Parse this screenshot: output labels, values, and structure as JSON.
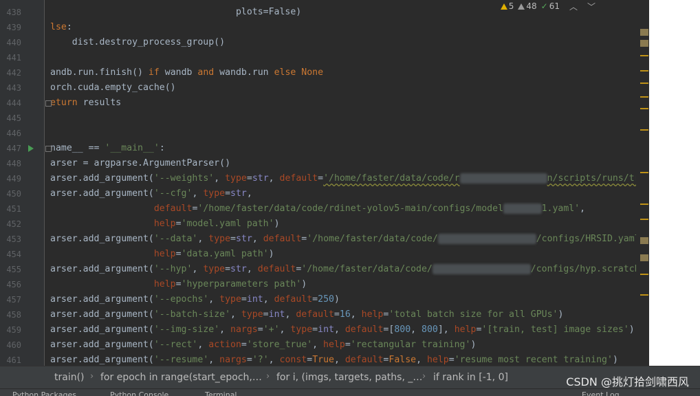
{
  "inspection": {
    "warnings_count": "5",
    "weak_warnings_count": "48",
    "typos_count": "61"
  },
  "lines": [
    {
      "num": "438",
      "tokens": [
        {
          "t": "                                  plots=False)",
          "c": ""
        }
      ]
    },
    {
      "num": "439",
      "tokens": [
        {
          "t": "lse",
          "c": "kw"
        },
        {
          "t": ":",
          "c": ""
        }
      ]
    },
    {
      "num": "440",
      "tokens": [
        {
          "t": "    dist.destroy_process_group()",
          "c": ""
        }
      ]
    },
    {
      "num": "441",
      "tokens": []
    },
    {
      "num": "442",
      "tokens": [
        {
          "t": "andb.run.finish() ",
          "c": ""
        },
        {
          "t": "if",
          "c": "kw"
        },
        {
          "t": " wandb ",
          "c": ""
        },
        {
          "t": "and",
          "c": "kw"
        },
        {
          "t": " wandb.run ",
          "c": ""
        },
        {
          "t": "else",
          "c": "kw"
        },
        {
          "t": " ",
          "c": ""
        },
        {
          "t": "None",
          "c": "kw"
        }
      ]
    },
    {
      "num": "443",
      "tokens": [
        {
          "t": "orch.cuda.empty_cache()",
          "c": ""
        }
      ]
    },
    {
      "num": "444",
      "tokens": [
        {
          "t": "eturn",
          "c": "kw"
        },
        {
          "t": " results",
          "c": ""
        }
      ]
    },
    {
      "num": "445",
      "tokens": []
    },
    {
      "num": "446",
      "tokens": []
    },
    {
      "num": "447",
      "tokens": [
        {
          "t": "name__ == ",
          "c": ""
        },
        {
          "t": "'__main__'",
          "c": "str"
        },
        {
          "t": ":",
          "c": ""
        }
      ]
    },
    {
      "num": "448",
      "tokens": [
        {
          "t": "arser = argparse.ArgumentParser()",
          "c": ""
        }
      ]
    },
    {
      "num": "449",
      "tokens": [
        {
          "t": "arser.add_argument(",
          "c": ""
        },
        {
          "t": "'--weights'",
          "c": "str"
        },
        {
          "t": ", ",
          "c": ""
        },
        {
          "t": "type",
          "c": "prm"
        },
        {
          "t": "=",
          "c": ""
        },
        {
          "t": "str",
          "c": "bi"
        },
        {
          "t": ", ",
          "c": ""
        },
        {
          "t": "default",
          "c": "prm"
        },
        {
          "t": "=",
          "c": ""
        },
        {
          "t": "'/home/faster/data/code/r",
          "c": "str wavy"
        },
        {
          "t": "dinet-yolov5-mai",
          "c": "str blur"
        },
        {
          "t": "n/scripts/runs/tra",
          "c": "str wavy"
        }
      ]
    },
    {
      "num": "450",
      "tokens": [
        {
          "t": "arser.add_argument(",
          "c": ""
        },
        {
          "t": "'--cfg'",
          "c": "str"
        },
        {
          "t": ", ",
          "c": ""
        },
        {
          "t": "type",
          "c": "prm"
        },
        {
          "t": "=",
          "c": ""
        },
        {
          "t": "str",
          "c": "bi"
        },
        {
          "t": ",",
          "c": ""
        }
      ]
    },
    {
      "num": "451",
      "tokens": [
        {
          "t": "                   ",
          "c": ""
        },
        {
          "t": "default",
          "c": "prm"
        },
        {
          "t": "=",
          "c": ""
        },
        {
          "t": "'/home/faster/data/code/rdinet-yolov5-main/configs/model",
          "c": "str"
        },
        {
          "t": "_xxxxxx",
          "c": "str blur"
        },
        {
          "t": "1.yaml'",
          "c": "str"
        },
        {
          "t": ",",
          "c": ""
        }
      ]
    },
    {
      "num": "452",
      "tokens": [
        {
          "t": "                   ",
          "c": ""
        },
        {
          "t": "help",
          "c": "prm"
        },
        {
          "t": "=",
          "c": ""
        },
        {
          "t": "'model.yaml path'",
          "c": "str"
        },
        {
          "t": ")",
          "c": ""
        }
      ]
    },
    {
      "num": "453",
      "tokens": [
        {
          "t": "arser.add_argument(",
          "c": ""
        },
        {
          "t": "'--data'",
          "c": "str"
        },
        {
          "t": ", ",
          "c": ""
        },
        {
          "t": "type",
          "c": "prm"
        },
        {
          "t": "=",
          "c": ""
        },
        {
          "t": "str",
          "c": "bi"
        },
        {
          "t": ", ",
          "c": ""
        },
        {
          "t": "default",
          "c": "prm"
        },
        {
          "t": "=",
          "c": ""
        },
        {
          "t": "'/home/faster/data/code/",
          "c": "str"
        },
        {
          "t": "rdinet-yolov5-main",
          "c": "str blur"
        },
        {
          "t": "/configs/HRSID.yaml'",
          "c": "str"
        }
      ]
    },
    {
      "num": "454",
      "tokens": [
        {
          "t": "                   ",
          "c": ""
        },
        {
          "t": "help",
          "c": "prm"
        },
        {
          "t": "=",
          "c": ""
        },
        {
          "t": "'data.yaml path'",
          "c": "str"
        },
        {
          "t": ")",
          "c": ""
        }
      ]
    },
    {
      "num": "455",
      "tokens": [
        {
          "t": "arser.add_argument(",
          "c": ""
        },
        {
          "t": "'--hyp'",
          "c": "str"
        },
        {
          "t": ", ",
          "c": ""
        },
        {
          "t": "type",
          "c": "prm"
        },
        {
          "t": "=",
          "c": ""
        },
        {
          "t": "str",
          "c": "bi"
        },
        {
          "t": ", ",
          "c": ""
        },
        {
          "t": "default",
          "c": "prm"
        },
        {
          "t": "=",
          "c": ""
        },
        {
          "t": "'/home/faster/data/code/",
          "c": "str"
        },
        {
          "t": "rdinet-yolov5-main",
          "c": "str blur"
        },
        {
          "t": "/configs/hyp.scratch.",
          "c": "str"
        }
      ]
    },
    {
      "num": "456",
      "tokens": [
        {
          "t": "                   ",
          "c": ""
        },
        {
          "t": "help",
          "c": "prm"
        },
        {
          "t": "=",
          "c": ""
        },
        {
          "t": "'hyperparameters path'",
          "c": "str"
        },
        {
          "t": ")",
          "c": ""
        }
      ]
    },
    {
      "num": "457",
      "tokens": [
        {
          "t": "arser.add_argument(",
          "c": ""
        },
        {
          "t": "'--epochs'",
          "c": "str"
        },
        {
          "t": ", ",
          "c": ""
        },
        {
          "t": "type",
          "c": "prm"
        },
        {
          "t": "=",
          "c": ""
        },
        {
          "t": "int",
          "c": "bi"
        },
        {
          "t": ", ",
          "c": ""
        },
        {
          "t": "default",
          "c": "prm"
        },
        {
          "t": "=",
          "c": ""
        },
        {
          "t": "250",
          "c": "num"
        },
        {
          "t": ")",
          "c": ""
        }
      ]
    },
    {
      "num": "458",
      "tokens": [
        {
          "t": "arser.add_argument(",
          "c": ""
        },
        {
          "t": "'--batch-size'",
          "c": "str"
        },
        {
          "t": ", ",
          "c": ""
        },
        {
          "t": "type",
          "c": "prm"
        },
        {
          "t": "=",
          "c": ""
        },
        {
          "t": "int",
          "c": "bi"
        },
        {
          "t": ", ",
          "c": ""
        },
        {
          "t": "default",
          "c": "prm"
        },
        {
          "t": "=",
          "c": ""
        },
        {
          "t": "16",
          "c": "num"
        },
        {
          "t": ", ",
          "c": ""
        },
        {
          "t": "help",
          "c": "prm"
        },
        {
          "t": "=",
          "c": ""
        },
        {
          "t": "'total batch size for all GPUs'",
          "c": "str"
        },
        {
          "t": ")",
          "c": ""
        }
      ]
    },
    {
      "num": "459",
      "tokens": [
        {
          "t": "arser.add_argument(",
          "c": ""
        },
        {
          "t": "'--img-size'",
          "c": "str"
        },
        {
          "t": ", ",
          "c": ""
        },
        {
          "t": "nargs",
          "c": "prm"
        },
        {
          "t": "=",
          "c": ""
        },
        {
          "t": "'+'",
          "c": "str"
        },
        {
          "t": ", ",
          "c": ""
        },
        {
          "t": "type",
          "c": "prm"
        },
        {
          "t": "=",
          "c": ""
        },
        {
          "t": "int",
          "c": "bi"
        },
        {
          "t": ", ",
          "c": ""
        },
        {
          "t": "default",
          "c": "prm"
        },
        {
          "t": "=[",
          "c": ""
        },
        {
          "t": "800",
          "c": "num"
        },
        {
          "t": ", ",
          "c": ""
        },
        {
          "t": "800",
          "c": "num"
        },
        {
          "t": "], ",
          "c": ""
        },
        {
          "t": "help",
          "c": "prm"
        },
        {
          "t": "=",
          "c": ""
        },
        {
          "t": "'[train, test] image sizes'",
          "c": "str"
        },
        {
          "t": ")",
          "c": ""
        }
      ]
    },
    {
      "num": "460",
      "tokens": [
        {
          "t": "arser.add_argument(",
          "c": ""
        },
        {
          "t": "'--rect'",
          "c": "str"
        },
        {
          "t": ", ",
          "c": ""
        },
        {
          "t": "action",
          "c": "prm"
        },
        {
          "t": "=",
          "c": ""
        },
        {
          "t": "'store_true'",
          "c": "str"
        },
        {
          "t": ", ",
          "c": ""
        },
        {
          "t": "help",
          "c": "prm"
        },
        {
          "t": "=",
          "c": ""
        },
        {
          "t": "'rectangular training'",
          "c": "str"
        },
        {
          "t": ")",
          "c": ""
        }
      ]
    },
    {
      "num": "461",
      "tokens": [
        {
          "t": "arser.add_argument(",
          "c": ""
        },
        {
          "t": "'--resume'",
          "c": "str"
        },
        {
          "t": ", ",
          "c": ""
        },
        {
          "t": "nargs",
          "c": "prm"
        },
        {
          "t": "=",
          "c": ""
        },
        {
          "t": "'?'",
          "c": "str"
        },
        {
          "t": ", ",
          "c": ""
        },
        {
          "t": "const",
          "c": "prm"
        },
        {
          "t": "=",
          "c": ""
        },
        {
          "t": "True",
          "c": "kw"
        },
        {
          "t": ", ",
          "c": ""
        },
        {
          "t": "default",
          "c": "prm"
        },
        {
          "t": "=",
          "c": ""
        },
        {
          "t": "False",
          "c": "kw"
        },
        {
          "t": ", ",
          "c": ""
        },
        {
          "t": "help",
          "c": "prm"
        },
        {
          "t": "=",
          "c": ""
        },
        {
          "t": "'resume most recent training'",
          "c": "str"
        },
        {
          "t": ")",
          "c": ""
        }
      ]
    }
  ],
  "breadcrumb": {
    "items": [
      "train()",
      "for epoch in range(start_epoch,…",
      "for i, (imgs, targets, paths, _…",
      "if rank in [-1, 0]"
    ]
  },
  "watermark": "CSDN @挑灯拾剑啸西风",
  "bottom_tabs": [
    "Python Packages",
    "Python Console",
    "Terminal",
    "Event Log"
  ],
  "colors": {
    "editor_bg": "#2b2b2b",
    "keyword": "#cc7832",
    "string": "#6a8759",
    "number": "#6897bb",
    "param": "#aa4926",
    "builtin": "#8888c6",
    "warning": "#e0b000",
    "ok": "#56a85a"
  }
}
